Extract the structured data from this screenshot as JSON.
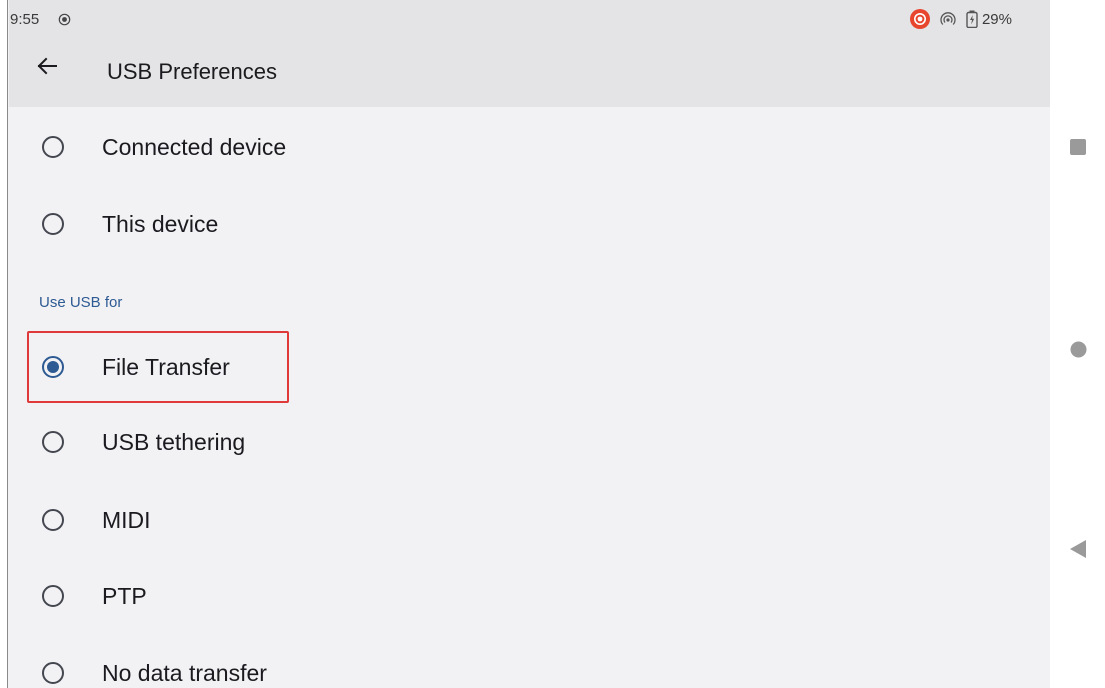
{
  "status_bar": {
    "time": "9:55",
    "battery_text": "29%",
    "icons": [
      "screen-record-icon",
      "recording-badge-icon",
      "hotspot-icon",
      "battery-icon"
    ],
    "record_color": "#e8452f"
  },
  "app_bar": {
    "title": "USB Preferences",
    "back_icon": "arrow-back-icon"
  },
  "options": {
    "connected_device": {
      "label": "Connected device",
      "selected": false
    },
    "this_device": {
      "label": "This device",
      "selected": false
    },
    "section_header": "Use USB for",
    "file_transfer": {
      "label": "File Transfer",
      "selected": true
    },
    "usb_tethering": {
      "label": "USB tethering",
      "selected": false
    },
    "midi": {
      "label": "MIDI",
      "selected": false
    },
    "ptp": {
      "label": "PTP",
      "selected": false
    },
    "no_data_transfer": {
      "label": "No data transfer",
      "selected": false
    }
  },
  "nav_bar": {
    "icons": [
      "recents-square-icon",
      "home-circle-icon",
      "back-triangle-icon"
    ]
  },
  "colors": {
    "accent": "#2d5a92",
    "highlight_box": "#e0393a",
    "app_bar_bg": "#e4e4e6",
    "page_bg": "#f2f2f5"
  }
}
